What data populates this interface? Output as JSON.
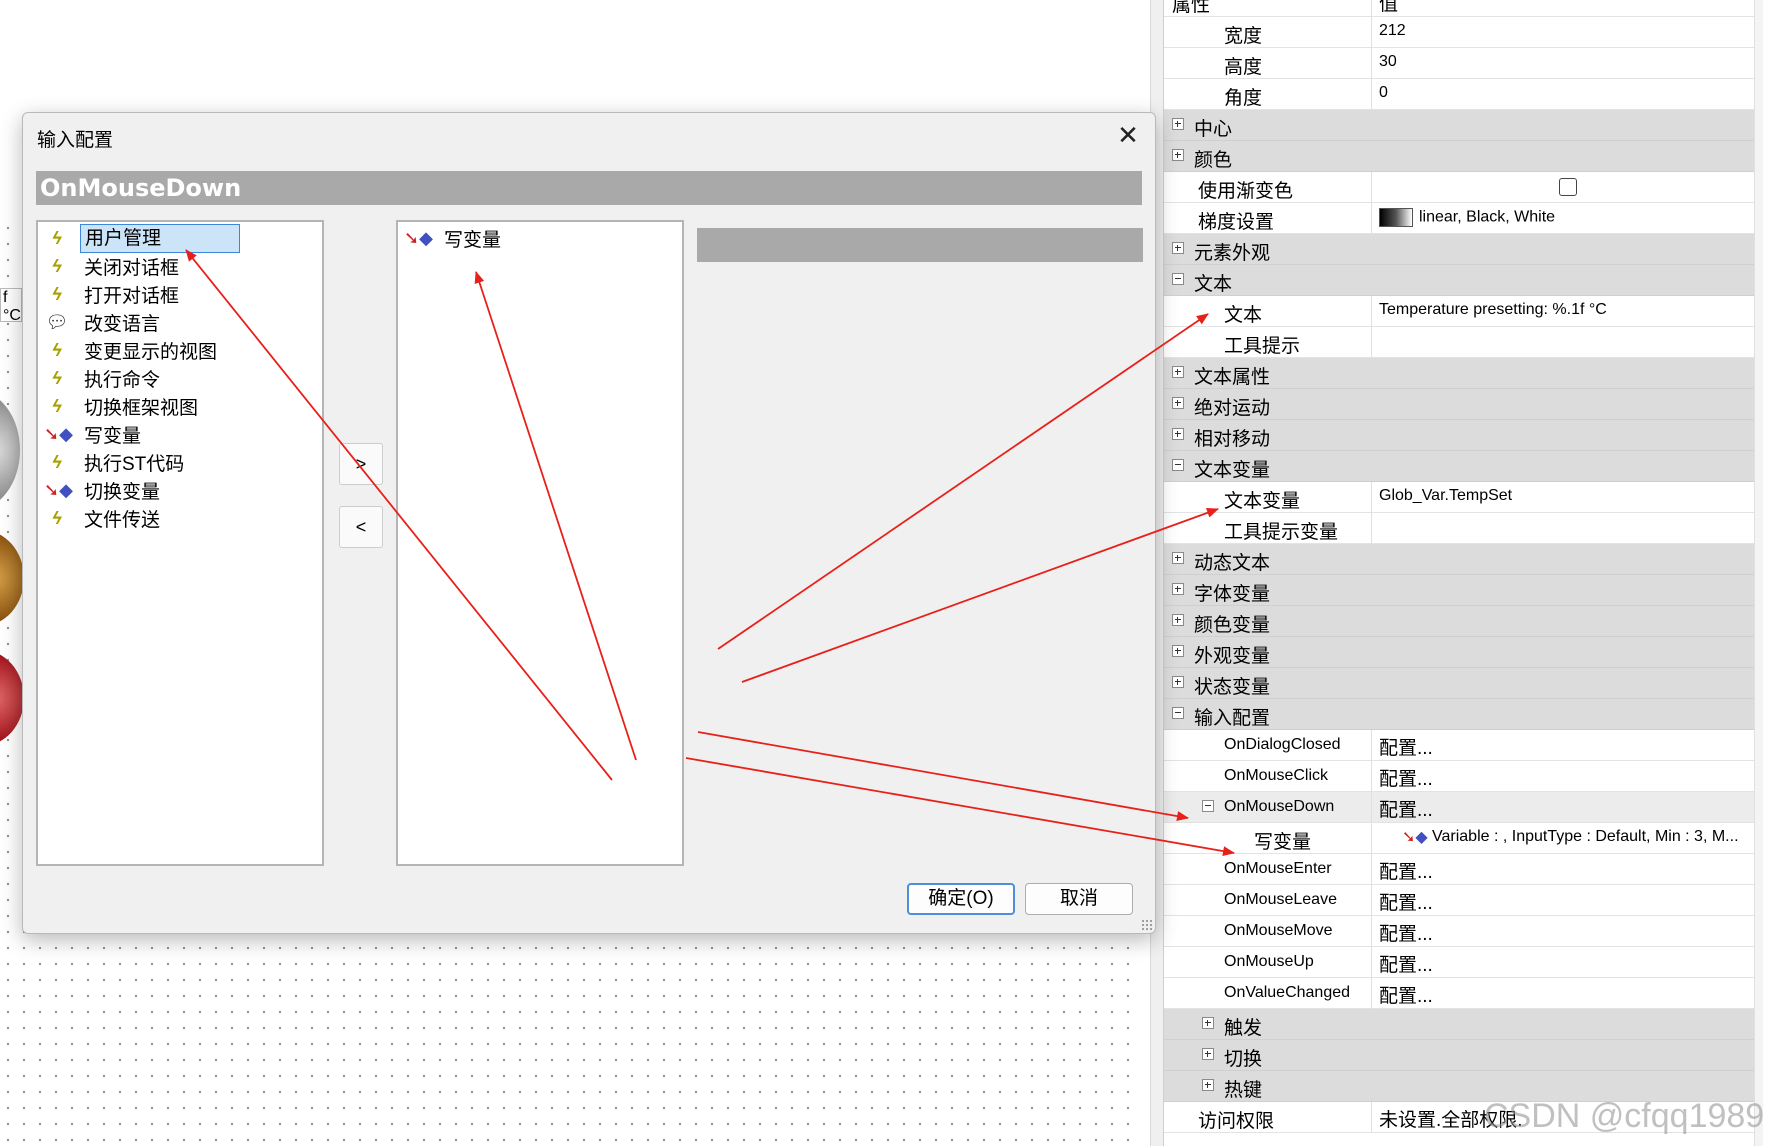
{
  "dialog": {
    "title": "输入配置",
    "close_glyph": "✕",
    "event_name": "OnMouseDown",
    "available_actions": [
      {
        "label": "用户管理",
        "icon": "lightning-icon",
        "selected": true
      },
      {
        "label": "关闭对话框",
        "icon": "lightning-icon"
      },
      {
        "label": "打开对话框",
        "icon": "lightning-icon"
      },
      {
        "label": "改变语言",
        "icon": "speech-bubble-icon"
      },
      {
        "label": "变更显示的视图",
        "icon": "lightning-icon"
      },
      {
        "label": "执行命令",
        "icon": "lightning-icon"
      },
      {
        "label": "切换框架视图",
        "icon": "lightning-icon"
      },
      {
        "label": "写变量",
        "icon": "variable-icon"
      },
      {
        "label": "执行ST代码",
        "icon": "lightning-icon"
      },
      {
        "label": "切换变量",
        "icon": "variable-icon"
      },
      {
        "label": "文件传送",
        "icon": "lightning-icon"
      }
    ],
    "configured_actions": [
      {
        "label": "写变量",
        "icon": "variable-icon"
      }
    ],
    "add_button": ">",
    "remove_button": "<",
    "ok_button": "确定(O)",
    "cancel_button": "取消"
  },
  "props": {
    "header_name": "属性",
    "header_value": "值",
    "width_label": "宽度",
    "width_value": "212",
    "height_label": "高度",
    "height_value": "30",
    "angle_label": "角度",
    "angle_value": "0",
    "center_label": "中心",
    "colors_label": "颜色",
    "use_gradient_label": "使用渐变色",
    "gradient_label": "梯度设置",
    "gradient_value": "linear, Black, White",
    "appearance_label": "元素外观",
    "text_group_label": "文本",
    "text_label": "文本",
    "text_value": "Temperature presetting: %.1f °C",
    "tooltip_label": "工具提示",
    "text_props_label": "文本属性",
    "abs_move_label": "绝对运动",
    "rel_move_label": "相对移动",
    "text_vars_label": "文本变量",
    "text_var_label": "文本变量",
    "text_var_value": "Glob_Var.TempSet",
    "tooltip_var_label": "工具提示变量",
    "dyn_text_label": "动态文本",
    "font_vars_label": "字体变量",
    "color_vars_label": "颜色变量",
    "look_vars_label": "外观变量",
    "state_vars_label": "状态变量",
    "input_cfg_label": "输入配置",
    "configure_value": "配置...",
    "on_dialog_closed": "OnDialogClosed",
    "on_mouse_click": "OnMouseClick",
    "on_mouse_down": "OnMouseDown",
    "write_var_label": "写变量",
    "write_var_value": "Variable : , InputType : Default, Min : 3, M...",
    "on_mouse_enter": "OnMouseEnter",
    "on_mouse_leave": "OnMouseLeave",
    "on_mouse_move": "OnMouseMove",
    "on_mouse_up": "OnMouseUp",
    "on_value_changed": "OnValueChanged",
    "trigger_label": "触发",
    "toggle_label": "切换",
    "hotkey_label": "热键",
    "access_label": "访问权限",
    "access_value": "未设置.全部权限."
  },
  "canvas": {
    "label_fragment": "f °C"
  },
  "watermark": "CSDN @cfqq1989",
  "colors": {
    "arrow": "#e8201a",
    "banner": "#a9a9a9",
    "selection": "#cce4f7",
    "group_row": "#dcdcdc"
  }
}
